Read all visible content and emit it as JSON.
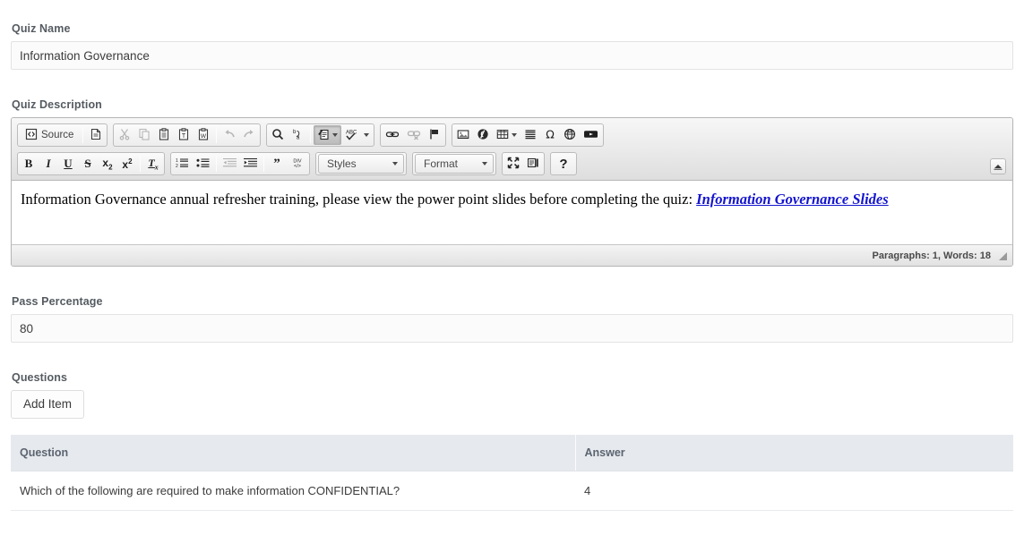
{
  "form": {
    "quiz_name": {
      "label": "Quiz Name",
      "value": "Information Governance",
      "placeholder": "Quiz Name"
    },
    "quiz_description": {
      "label": "Quiz Description",
      "body_text": "Information Governance annual refresher training, please view the power point slides before completing the quiz: ",
      "body_link_text": "Information Governance Slides",
      "status": "Paragraphs: 1, Words: 18"
    },
    "pass_percentage": {
      "label": "Pass Percentage",
      "value": "80",
      "placeholder": "Pass Percentage"
    },
    "questions": {
      "label": "Questions",
      "add_item_label": "Add Item",
      "columns": [
        "Question",
        "Answer"
      ],
      "rows": [
        {
          "question": "Which of the following are required to make information CONFIDENTIAL?",
          "answer": "4"
        }
      ]
    }
  },
  "editor": {
    "toolbar_row1": [
      {
        "group": "document",
        "items": [
          {
            "name": "source-button",
            "label": "Source",
            "icon": "source-icon",
            "state": "normal"
          },
          {
            "name": "new-page-button",
            "label": "",
            "icon": "new-page-icon",
            "state": "normal"
          }
        ]
      },
      {
        "group": "clipboard",
        "items": [
          {
            "name": "cut-button",
            "label": "",
            "icon": "scissors-icon",
            "state": "disabled"
          },
          {
            "name": "copy-button",
            "label": "",
            "icon": "copy-icon",
            "state": "disabled"
          },
          {
            "name": "paste-button",
            "label": "",
            "icon": "paste-icon",
            "state": "normal"
          },
          {
            "name": "paste-text-button",
            "label": "",
            "icon": "paste-text-icon",
            "state": "normal"
          },
          {
            "name": "paste-word-button",
            "label": "",
            "icon": "paste-word-icon",
            "state": "normal"
          },
          {
            "name": "undo-button",
            "label": "",
            "icon": "undo-icon",
            "state": "disabled"
          },
          {
            "name": "redo-button",
            "label": "",
            "icon": "redo-icon",
            "state": "disabled"
          }
        ]
      },
      {
        "group": "editing",
        "items": [
          {
            "name": "find-button",
            "label": "",
            "icon": "magnifier-icon",
            "state": "normal"
          },
          {
            "name": "replace-button",
            "label": "",
            "icon": "replace-icon",
            "state": "normal"
          },
          {
            "name": "scayt-button",
            "label": "",
            "icon": "scayt-icon",
            "state": "active"
          },
          {
            "name": "spellcheck-button",
            "label": "",
            "icon": "abc-check-icon",
            "state": "normal"
          }
        ]
      },
      {
        "group": "links",
        "items": [
          {
            "name": "link-button",
            "label": "",
            "icon": "chain-link-icon",
            "state": "normal"
          },
          {
            "name": "unlink-button",
            "label": "",
            "icon": "broken-link-icon",
            "state": "disabled"
          },
          {
            "name": "anchor-button",
            "label": "",
            "icon": "flag-icon",
            "state": "normal"
          }
        ]
      },
      {
        "group": "insert",
        "items": [
          {
            "name": "image-button",
            "label": "",
            "icon": "image-icon",
            "state": "normal"
          },
          {
            "name": "flash-button",
            "label": "",
            "icon": "flash-icon",
            "state": "normal"
          },
          {
            "name": "table-button",
            "label": "",
            "icon": "table-icon",
            "state": "normal"
          },
          {
            "name": "horizontal-rule-button",
            "label": "",
            "icon": "horizontal-rule-icon",
            "state": "normal"
          },
          {
            "name": "special-char-button",
            "label": "",
            "icon": "omega-icon",
            "state": "normal"
          },
          {
            "name": "page-break-button",
            "label": "",
            "icon": "globe-icon",
            "state": "normal"
          },
          {
            "name": "youtube-button",
            "label": "",
            "icon": "youtube-icon",
            "state": "normal"
          }
        ]
      }
    ],
    "toolbar_row2": [
      {
        "group": "basicstyles",
        "items": [
          {
            "name": "bold-button",
            "label": "B",
            "icon": "bold-icon",
            "state": "normal"
          },
          {
            "name": "italic-button",
            "label": "I",
            "icon": "italic-icon",
            "state": "normal"
          },
          {
            "name": "underline-button",
            "label": "U",
            "icon": "underline-icon",
            "state": "normal"
          },
          {
            "name": "strikethrough-button",
            "label": "S",
            "icon": "strikethrough-icon",
            "state": "normal"
          },
          {
            "name": "subscript-button",
            "label": "x",
            "icon": "subscript-icon",
            "state": "normal"
          },
          {
            "name": "superscript-button",
            "label": "x",
            "icon": "superscript-icon",
            "state": "normal"
          },
          {
            "name": "remove-format-button",
            "label": "Tx",
            "icon": "remove-format-icon",
            "state": "normal"
          }
        ]
      },
      {
        "group": "paragraph",
        "items": [
          {
            "name": "numbered-list-button",
            "label": "",
            "icon": "numbered-list-icon",
            "state": "normal"
          },
          {
            "name": "bulleted-list-button",
            "label": "",
            "icon": "bulleted-list-icon",
            "state": "normal"
          },
          {
            "name": "outdent-button",
            "label": "",
            "icon": "outdent-icon",
            "state": "disabled"
          },
          {
            "name": "indent-button",
            "label": "",
            "icon": "indent-icon",
            "state": "normal"
          },
          {
            "name": "blockquote-button",
            "label": "",
            "icon": "blockquote-icon",
            "state": "normal"
          },
          {
            "name": "div-container-button",
            "label": "",
            "icon": "div-container-icon",
            "state": "normal"
          }
        ]
      },
      {
        "group": "styles",
        "items": [
          {
            "name": "styles-combo",
            "label": "Styles",
            "icon": "chevron-down-icon",
            "state": "normal"
          }
        ]
      },
      {
        "group": "format",
        "items": [
          {
            "name": "format-combo",
            "label": "Format",
            "icon": "chevron-down-icon",
            "state": "normal"
          }
        ]
      },
      {
        "group": "tools",
        "items": [
          {
            "name": "maximize-button",
            "label": "",
            "icon": "maximize-icon",
            "state": "normal"
          },
          {
            "name": "show-blocks-button",
            "label": "",
            "icon": "show-blocks-icon",
            "state": "normal"
          }
        ]
      },
      {
        "group": "about",
        "items": [
          {
            "name": "about-button",
            "label": "?",
            "icon": "question-mark-icon",
            "state": "normal"
          }
        ]
      }
    ],
    "collapse_toolbar": {
      "name": "collapse-toolbar-button",
      "icon": "chevron-up-icon"
    }
  },
  "colors": {
    "label": "#555b61",
    "input_bg": "#fbfbfb",
    "input_border": "#e3e3e3",
    "table_header_bg": "#e6eaee",
    "link": "#1414cf",
    "toolbar_top": "#f7f7f7",
    "toolbar_bottom": "#dedede"
  }
}
